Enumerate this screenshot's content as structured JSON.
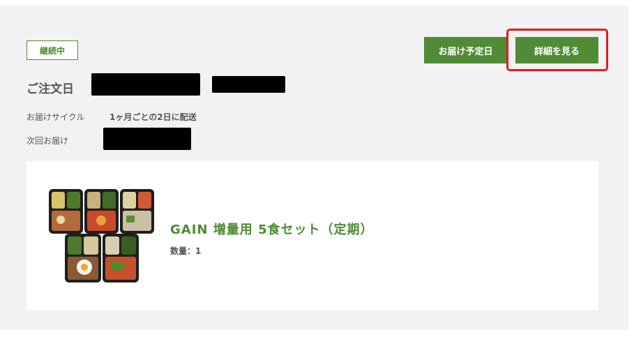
{
  "order": {
    "status_badge": "継続中",
    "delivery_date_button": "お届け予定日",
    "detail_button": "詳細を見る",
    "order_date_label": "ご注文日",
    "cycle_label": "お届けサイクル",
    "cycle_value": "1ヶ月ごとの2日に配送",
    "next_delivery_label": "次回お届け"
  },
  "product": {
    "name": "GAIN 増量用 5食セット（定期）",
    "quantity": "数量：1",
    "image_icon": "meal-trays-image"
  },
  "colors": {
    "accent": "#508b35",
    "highlight": "#d91f1f",
    "card_bg": "#f2f2f4"
  }
}
